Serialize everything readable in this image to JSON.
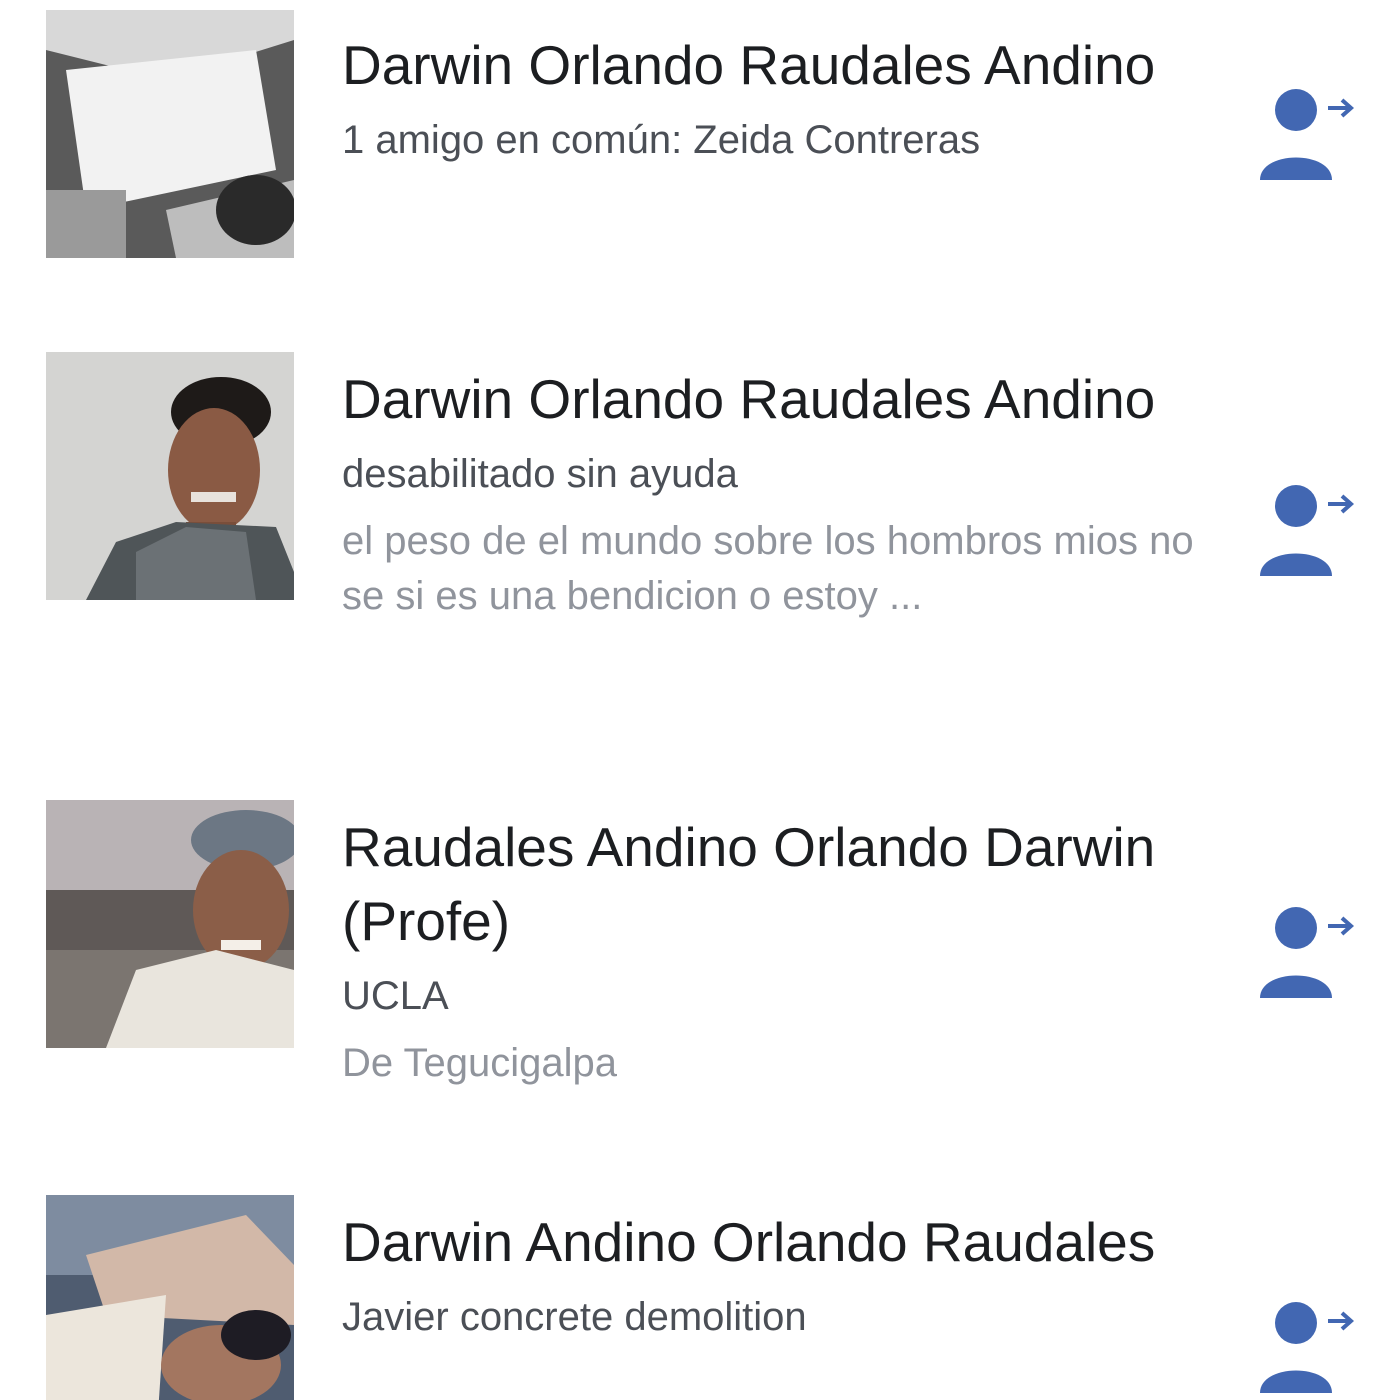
{
  "colors": {
    "accent": "#4267b2",
    "name_text": "#1c1e21",
    "secondary_text": "#4b4f56",
    "tertiary_text": "#90949c"
  },
  "results": [
    {
      "name": "Darwin Orlando Raudales Andino",
      "line1": "1 amigo en común: Zeida Contreras",
      "line2": "",
      "action_icon": "add-friend-icon"
    },
    {
      "name": "Darwin Orlando Raudales Andino",
      "line1": "desabilitado sin ayuda",
      "line2": "el peso de el mundo sobre los hombros mios no se si es una bendicion o estoy ...",
      "action_icon": "add-friend-icon"
    },
    {
      "name": "Raudales Andino Orlando Darwin (Profe)",
      "line1": "UCLA",
      "line2": "De Tegucigalpa",
      "action_icon": "add-friend-icon"
    },
    {
      "name": "Darwin Andino Orlando Raudales",
      "line1": "Javier concrete demolition",
      "line2": "",
      "action_icon": "add-friend-icon"
    }
  ]
}
